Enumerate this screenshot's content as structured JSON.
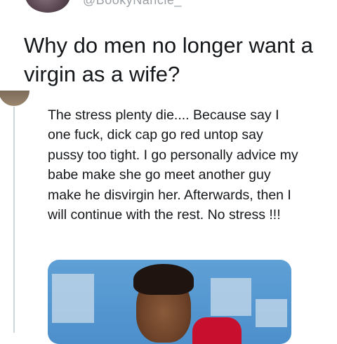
{
  "header": {
    "handle": "@BookyNancie_"
  },
  "tweet": {
    "question": "Why do men no longer want a virgin as a wife?"
  },
  "reply": {
    "text": "The stress plenty die.... Because say I one fuck, dick cap go red untop say pussy too tight. I go personally advice my babe make she go meet another guy make he disvirgin her. Afterwards, then I will continue with the rest. No stress !!!"
  },
  "colors": {
    "text": "#14171a",
    "muted": "#9aa0a6",
    "thread_line": "#ccd6dd",
    "media_sky": "#4c8fcb"
  }
}
